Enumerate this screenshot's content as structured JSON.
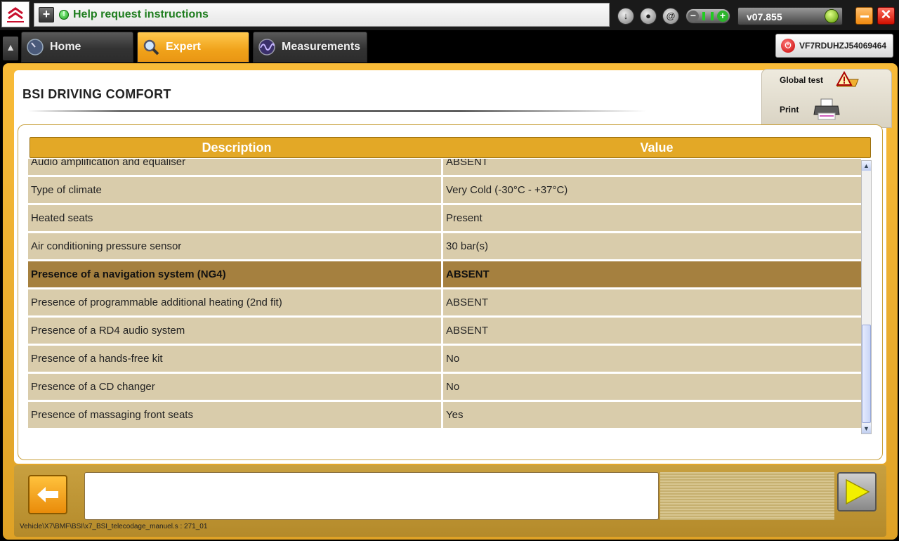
{
  "window": {
    "help_text": "Help request instructions",
    "version": "v07.855",
    "close_label": "✕"
  },
  "tabs": [
    {
      "label": "Home",
      "active": false
    },
    {
      "label": "Expert",
      "active": true
    },
    {
      "label": "Measurements",
      "active": false
    }
  ],
  "vin": "VF7RDUHZJ54069464",
  "page": {
    "title": "BSI  DRIVING COMFORT"
  },
  "side_actions": {
    "global_test": "Global test",
    "print": "Print"
  },
  "table": {
    "headers": [
      "Description",
      "Value"
    ],
    "selected_index": 4,
    "rows": [
      {
        "description": "Audio amplification and equaliser",
        "value": "ABSENT"
      },
      {
        "description": "Type of climate",
        "value": "Very Cold (-30°C - +37°C)"
      },
      {
        "description": "Heated seats",
        "value": "Present"
      },
      {
        "description": "Air conditioning pressure sensor",
        "value": "30 bar(s)"
      },
      {
        "description": "Presence of a navigation system (NG4)",
        "value": "ABSENT"
      },
      {
        "description": "Presence of programmable additional heating (2nd fit)",
        "value": "ABSENT"
      },
      {
        "description": "Presence of a RD4 audio system",
        "value": "ABSENT"
      },
      {
        "description": "Presence of a hands-free kit",
        "value": "No"
      },
      {
        "description": "Presence of a CD changer",
        "value": "No"
      },
      {
        "description": "Presence of massaging front seats",
        "value": "Yes"
      }
    ]
  },
  "footer": {
    "message": "",
    "path": "Vehicle\\X7\\BMF\\BSI\\x7_BSI_telecodage_manuel.s : 271_01"
  },
  "colors": {
    "accent": "#f0a21a",
    "row_bg": "#d9ccab",
    "row_selected": "#a5803f",
    "header_bg": "#e3a826"
  }
}
